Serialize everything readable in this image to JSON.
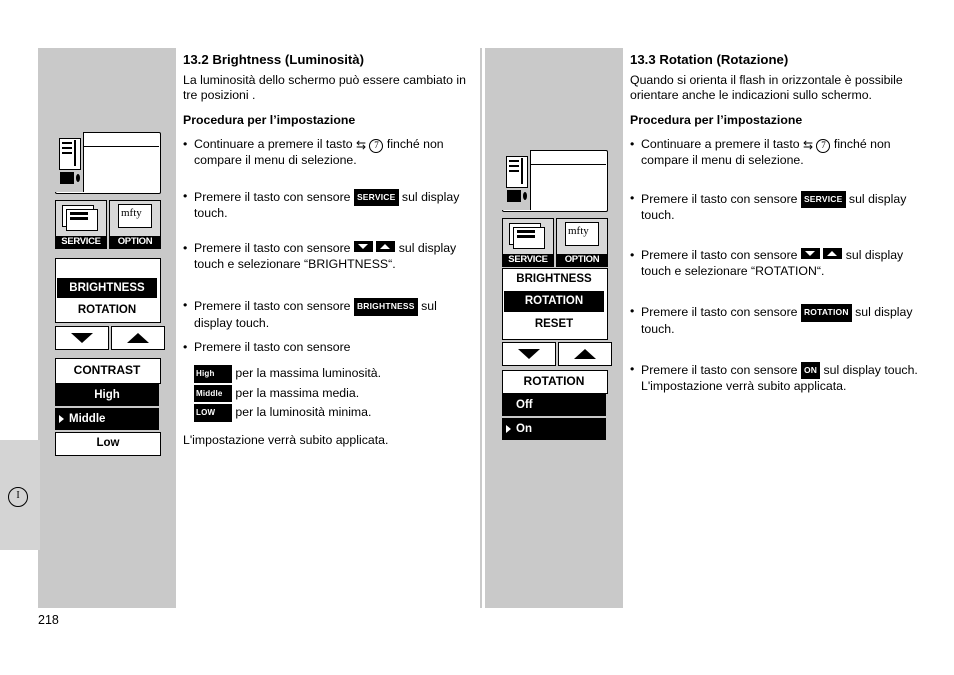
{
  "page": {
    "number": "218",
    "language_badge": "I"
  },
  "column1": {
    "heading": "13.2 Brightness (Luminosità)",
    "intro": "La luminosità dello schermo può essere cambiato in tre posizioni .",
    "procedure_title": "Procedura per l’impostazione",
    "steps": [
      {
        "pre": "Continuare a premere il tasto ",
        "key": "",
        "post": " finché non compare il menu di selezione."
      },
      {
        "pre": "Premere il tasto con sensore ",
        "key": "SERVICE",
        "post": " sul display touch."
      },
      {
        "pre": "Premere il tasto con sensore ",
        "key": "",
        "post": " sul display touch e selezionare “BRIGHTNESS“."
      },
      {
        "pre": "Premere il tasto con sensore ",
        "key": "BRIGHTNESS",
        "post": " sul display touch."
      },
      {
        "pre": "Premere il tasto con sensore",
        "key": "",
        "post": ""
      }
    ],
    "options": [
      {
        "key": "High",
        "text": "per la massima luminosità."
      },
      {
        "key": "Middle",
        "text": "per la massima media."
      },
      {
        "key": "LOW",
        "text": "per la luminosità minima."
      }
    ],
    "footer": "L'impostazione verrà subito applicata."
  },
  "column2": {
    "heading": "13.3 Rotation (Rotazione)",
    "intro": "Quando si orienta il flash in orizzontale è possibile orientare anche le indicazioni sullo schermo.",
    "procedure_title": "Procedura per l’impostazione",
    "steps": [
      {
        "pre": "Continuare a premere il tasto ",
        "key": "",
        "post": " finché non compare il menu di selezione."
      },
      {
        "pre": "Premere il tasto con sensore ",
        "key": "SERVICE",
        "post": " sul display touch."
      },
      {
        "pre": "Premere il tasto con sensore ",
        "key": "",
        "post": " sul display touch e selezionare “ROTATION“."
      },
      {
        "pre": "Premere il tasto con sensore ",
        "key": "ROTATION",
        "post": " sul display touch."
      },
      {
        "pre": "Premere il tasto con sensore ",
        "key": "ON",
        "post": " sul display touch."
      }
    ],
    "footer": "L'impostazione verrà subito applicata."
  },
  "illustration1": {
    "icons": [
      {
        "label": "SERVICE"
      },
      {
        "label": "OPTION",
        "top": "mfty"
      }
    ],
    "menu": [
      {
        "label": "BRIGHTNESS",
        "style": "black"
      },
      {
        "label": "ROTATION",
        "style": "white"
      }
    ],
    "panel_title": "CONTRAST",
    "panel_items": [
      {
        "label": "High",
        "style": "black",
        "marker": false
      },
      {
        "label": "Middle",
        "style": "black",
        "marker": true
      },
      {
        "label": "Low",
        "style": "white",
        "marker": false
      }
    ]
  },
  "illustration2": {
    "icons": [
      {
        "label": "SERVICE"
      },
      {
        "label": "OPTION",
        "top": "mfty"
      }
    ],
    "menu": [
      {
        "label": "BRIGHTNESS",
        "style": "white"
      },
      {
        "label": "ROTATION",
        "style": "black"
      },
      {
        "label": "RESET",
        "style": "white"
      }
    ],
    "panel_title": "ROTATION",
    "panel_items": [
      {
        "label": "Off",
        "style": "black",
        "marker": false
      },
      {
        "label": "On",
        "style": "black",
        "marker": true
      }
    ]
  }
}
